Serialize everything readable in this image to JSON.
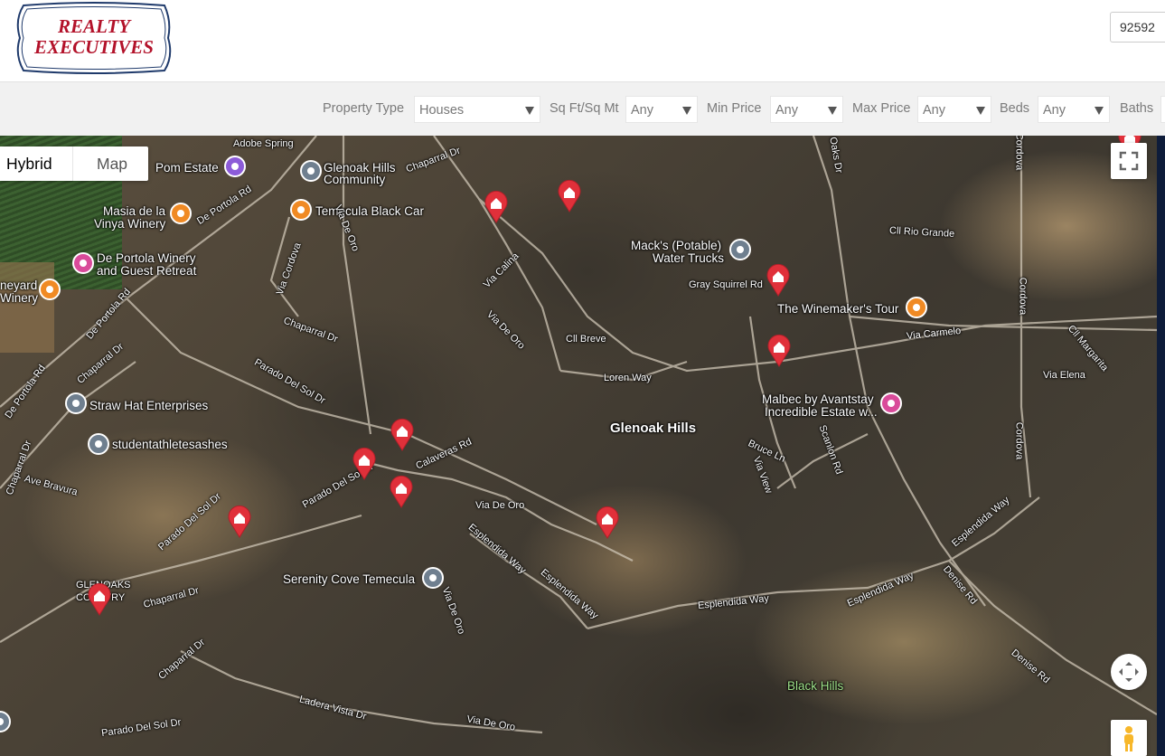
{
  "brand": {
    "line1": "REALTY",
    "line2": "EXECUTIVES"
  },
  "search": {
    "zip_value": "92592"
  },
  "filters": [
    {
      "label": "Property Type",
      "value": "Houses"
    },
    {
      "label": "Sq Ft/Sq Mt",
      "value": "Any"
    },
    {
      "label": "Min Price",
      "value": "Any"
    },
    {
      "label": "Max Price",
      "value": "Any"
    },
    {
      "label": "Beds",
      "value": "Any"
    },
    {
      "label": "Baths",
      "value": ""
    }
  ],
  "map": {
    "type_options": [
      "Hybrid",
      "Map"
    ],
    "selected_type": "Hybrid",
    "place_labels": {
      "adobe_spring": "Adobe Spring",
      "pom_estate": "Pom Estate",
      "glenoak_community_1": "Glenoak Hills",
      "glenoak_community_2": "Community",
      "masia_1": "Masia de la",
      "masia_2": "Vinya Winery",
      "temecula_black_car": "Temecula Black Car",
      "de_portola_winery_1": "De Portola Winery",
      "de_portola_winery_2": "and Guest Retreat",
      "neyard": "neyard",
      "winery": "Winery",
      "macks_1": "Mack's (Potable)",
      "macks_2": "Water Trucks",
      "winemakers_tour": "The Winemaker's Tour",
      "malbec_1": "Malbec by Avantstay",
      "malbec_2": "Incredible Estate w...",
      "straw_hat": "Straw Hat Enterprises",
      "student": "studentathletesashes",
      "glenoak_hills": "Glenoak Hills",
      "serenity_cove": "Serenity Cove Temecula",
      "black_hills": "Black Hills",
      "gle_country_1": "GLENOAKS",
      "gle_country_2": "COUNTRY"
    },
    "road_labels": {
      "chaparral_dr_top": "Chaparral Dr",
      "de_portola_rd_1": "De Portola Rd",
      "de_portola_rd_2": "De Portola Rd",
      "de_portola_rd_3": "De Portola Rd",
      "via_de_oro_1": "Via De Oro",
      "via_cordova": "Via Cordova",
      "via_calina": "Via Calina",
      "cll_rio_grande": "Cll Rio Grande",
      "gray_squirrel_rd": "Gray Squirrel Rd",
      "chaparral_dr_mid": "Chaparral Dr",
      "via_de_oro_2": "Via De Oro",
      "cll_breve": "Cll Breve",
      "via_carmelo": "Via Carmelo",
      "cordova_1": "Cordova",
      "cordova_2": "Cordova",
      "cll_margarita": "Cll Margarita",
      "via_elena": "Via Elena",
      "loren_way": "Loren Way",
      "chaparral_dr_left": "Chaparral Dr",
      "parado_del_sol_dr_1": "Parado Del Sol Dr",
      "calaveras_rd": "Calaveras Rd",
      "bruce_ln": "Bruce Ln",
      "via_view": "Via View",
      "scanlon_rd": "Scanlon Rd",
      "cordova_3": "Cordova",
      "parado_del_sol_dr_2": "Parado Del Sol Dr",
      "ave_bravura": "Ave Bravura",
      "parado_del_sol_dr_3": "Parado Del Sol Dr",
      "via_de_oro_3": "Via De Oro",
      "esplendida_way_1": "Esplendida Way",
      "esplendida_way_2": "Esplendida Way",
      "esplendida_way_3": "Esplendida Way",
      "esplendida_way_4": "Esplendida Way",
      "esplendida_way_5": "Esplendida Way",
      "denise_rd_1": "Denise Rd",
      "denise_rd_2": "Denise Rd",
      "chaparral_dr_bottom": "Chaparral Dr",
      "chaparral_dr_bottom2": "Chaparral Dr",
      "via_de_oro_4": "Via De Oro",
      "ladera_vista_dr": "Ladera Vista Dr",
      "parado_del_sol_dr_4": "Parado Del Sol Dr",
      "via_de_oro_5": "Via De Oro",
      "oaks_dr": "Oaks Dr",
      "chaparral_lbl": "Chaparral Dr"
    }
  }
}
